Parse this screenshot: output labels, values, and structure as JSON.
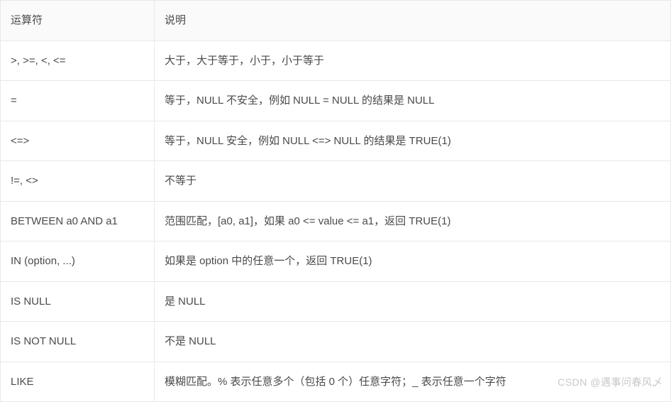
{
  "table": {
    "headers": {
      "operator": "运算符",
      "description": "说明"
    },
    "rows": [
      {
        "operator": ">, >=, <, <=",
        "description": "大于，大于等于，小于，小于等于"
      },
      {
        "operator": "=",
        "description": "等于，NULL 不安全，例如 NULL = NULL 的结果是 NULL"
      },
      {
        "operator": "<=>",
        "description": "等于，NULL 安全，例如 NULL <=> NULL 的结果是 TRUE(1)"
      },
      {
        "operator": "!=, <>",
        "description": "不等于"
      },
      {
        "operator": "BETWEEN a0 AND a1",
        "description": "范围匹配，[a0, a1]，如果 a0 <= value <= a1，返回 TRUE(1)"
      },
      {
        "operator": "IN (option, ...)",
        "description": "如果是 option 中的任意一个，返回 TRUE(1)"
      },
      {
        "operator": "IS NULL",
        "description": "是 NULL"
      },
      {
        "operator": "IS NOT NULL",
        "description": "不是 NULL"
      },
      {
        "operator": "LIKE",
        "description": "模糊匹配。% 表示任意多个（包括 0 个）任意字符；_ 表示任意一个字符"
      }
    ]
  },
  "watermark": "CSDN @遇事问春风乄"
}
